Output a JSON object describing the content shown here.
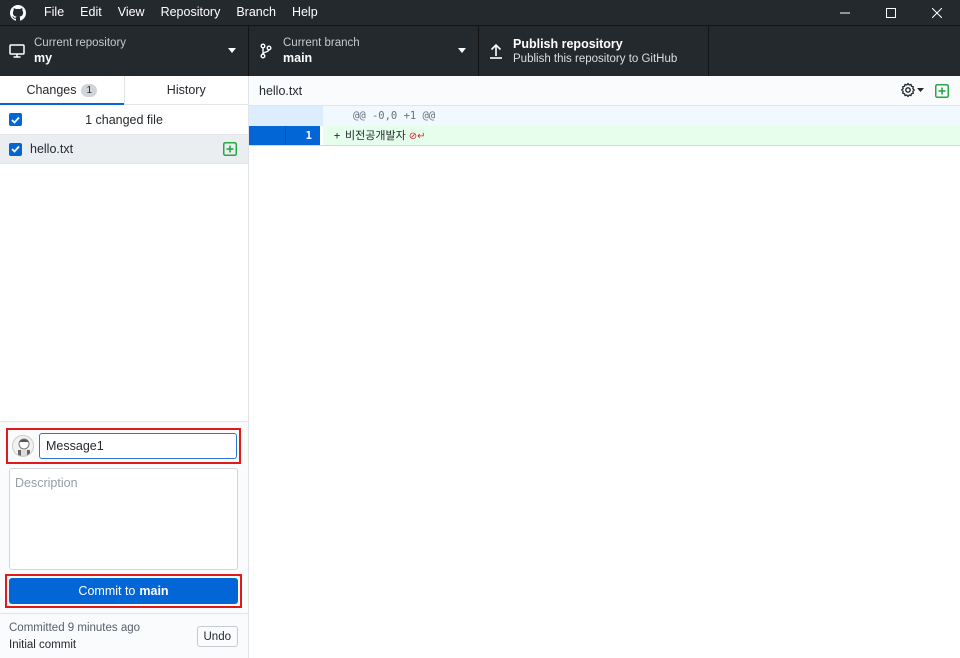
{
  "app": {
    "menu": [
      "File",
      "Edit",
      "View",
      "Repository",
      "Branch",
      "Help"
    ]
  },
  "toolbar": {
    "repo_caption": "Current repository",
    "repo_name": "my",
    "branch_caption": "Current branch",
    "branch_name": "main",
    "publish_title": "Publish repository",
    "publish_subtitle": "Publish this repository to GitHub"
  },
  "sidebar": {
    "tabs": [
      {
        "label": "Changes",
        "count": "1",
        "active": true
      },
      {
        "label": "History",
        "active": false
      }
    ],
    "changed_summary": "1 changed file",
    "files": [
      {
        "name": "hello.txt",
        "status": "added",
        "checked": true
      }
    ]
  },
  "commit": {
    "summary_value": "Message1",
    "description_placeholder": "Description",
    "button_prefix": "Commit to",
    "button_branch": "main"
  },
  "last_commit": {
    "time_text": "Committed 9 minutes ago",
    "message": "Initial commit",
    "undo_label": "Undo"
  },
  "diff": {
    "file_path": "hello.txt",
    "hunk_header": "@@ -0,0 +1 @@",
    "lines": [
      {
        "new_line_no": "1",
        "sign": "+",
        "text": "비전공개발자",
        "no_newline_marks": "⊘↵"
      }
    ]
  },
  "colors": {
    "accent": "#0366d6",
    "highlight_border": "#e01a1a",
    "added_bg": "#e6ffed",
    "titlebar_bg": "#24292e"
  }
}
